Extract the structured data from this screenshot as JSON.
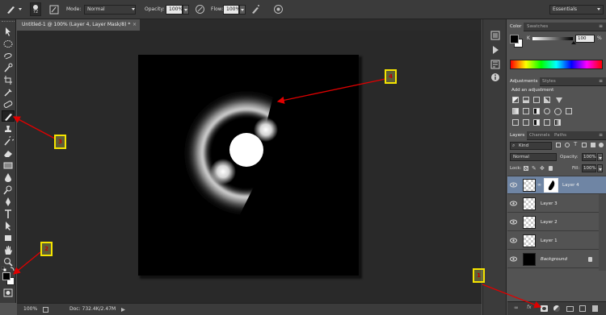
{
  "options_bar": {
    "brush_size": "72",
    "mode_label": "Mode:",
    "mode_value": "Normal",
    "opacity_label": "Opacity:",
    "opacity_value": "100%",
    "flow_label": "Flow:",
    "flow_value": "100%",
    "workspace": "Essentials"
  },
  "document": {
    "tab_title": "Untitled-1 @ 100% (Layer 4, Layer Mask/8) *",
    "zoom": "100%",
    "doc_info": "Doc: 732.4K/2.47M"
  },
  "color_panel": {
    "tabs": [
      "Color",
      "Swatches"
    ],
    "channel_label": "K",
    "channel_value": "100",
    "percent_sign": "%"
  },
  "adjustments_panel": {
    "tabs": [
      "Adjustments",
      "Styles"
    ],
    "heading": "Add an adjustment"
  },
  "layers_panel": {
    "tabs": [
      "Layers",
      "Channels",
      "Paths"
    ],
    "filter_kind": "Kind",
    "blend_mode": "Normal",
    "opacity_label": "Opacity:",
    "opacity_value": "100%",
    "lock_label": "Lock:",
    "fill_label": "Fill:",
    "fill_value": "100%",
    "layers": [
      {
        "name": "Layer 4",
        "selected": true
      },
      {
        "name": "Layer 3",
        "selected": false
      },
      {
        "name": "Layer 2",
        "selected": false
      },
      {
        "name": "Layer 1",
        "selected": false
      },
      {
        "name": "Background",
        "selected": false
      }
    ]
  },
  "annotations": [
    "1",
    "2",
    "3",
    "4"
  ],
  "colors": {
    "annotation_box": "#f5e400",
    "annotation_arrow": "#e00000",
    "selected_layer": "#6f85a4"
  }
}
